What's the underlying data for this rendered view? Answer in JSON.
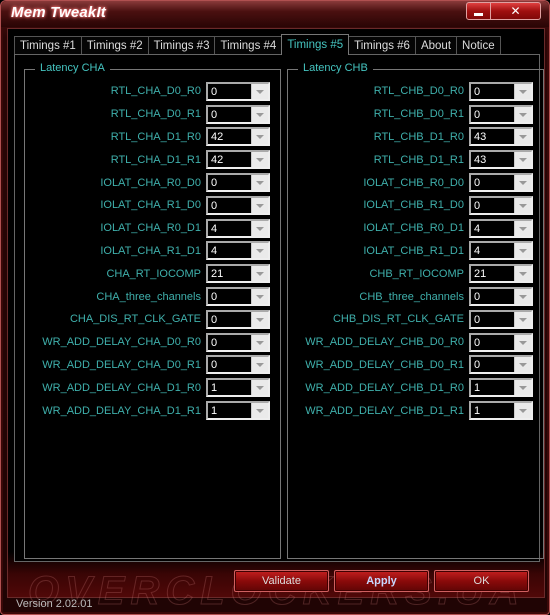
{
  "window": {
    "title": "Mem TweakIt",
    "minimize_glyph": "minimize-icon",
    "close_glyph": "✕"
  },
  "tabs": [
    {
      "label": "Timings #1",
      "active": false
    },
    {
      "label": "Timings #2",
      "active": false
    },
    {
      "label": "Timings #3",
      "active": false
    },
    {
      "label": "Timings #4",
      "active": false
    },
    {
      "label": "Timings #5",
      "active": true
    },
    {
      "label": "Timings #6",
      "active": false
    },
    {
      "label": "About",
      "active": false
    },
    {
      "label": "Notice",
      "active": false
    }
  ],
  "groups": {
    "cha": {
      "title": "Latency CHA",
      "rows": [
        {
          "label": "RTL_CHA_D0_R0",
          "value": "0"
        },
        {
          "label": "RTL_CHA_D0_R1",
          "value": "0"
        },
        {
          "label": "RTL_CHA_D1_R0",
          "value": "42"
        },
        {
          "label": "RTL_CHA_D1_R1",
          "value": "42"
        },
        {
          "label": "IOLAT_CHA_R0_D0",
          "value": "0"
        },
        {
          "label": "IOLAT_CHA_R1_D0",
          "value": "0"
        },
        {
          "label": "IOLAT_CHA_R0_D1",
          "value": "4"
        },
        {
          "label": "IOLAT_CHA_R1_D1",
          "value": "4"
        },
        {
          "label": "CHA_RT_IOCOMP",
          "value": "21"
        },
        {
          "label": "CHA_three_channels",
          "value": "0"
        },
        {
          "label": "CHA_DIS_RT_CLK_GATE",
          "value": "0"
        },
        {
          "label": "WR_ADD_DELAY_CHA_D0_R0",
          "value": "0"
        },
        {
          "label": "WR_ADD_DELAY_CHA_D0_R1",
          "value": "0"
        },
        {
          "label": "WR_ADD_DELAY_CHA_D1_R0",
          "value": "1"
        },
        {
          "label": "WR_ADD_DELAY_CHA_D1_R1",
          "value": "1"
        }
      ]
    },
    "chb": {
      "title": "Latency CHB",
      "rows": [
        {
          "label": "RTL_CHB_D0_R0",
          "value": "0"
        },
        {
          "label": "RTL_CHB_D0_R1",
          "value": "0"
        },
        {
          "label": "RTL_CHB_D1_R0",
          "value": "43"
        },
        {
          "label": "RTL_CHB_D1_R1",
          "value": "43"
        },
        {
          "label": "IOLAT_CHB_R0_D0",
          "value": "0"
        },
        {
          "label": "IOLAT_CHB_R1_D0",
          "value": "0"
        },
        {
          "label": "IOLAT_CHB_R0_D1",
          "value": "4"
        },
        {
          "label": "IOLAT_CHB_R1_D1",
          "value": "4"
        },
        {
          "label": "CHB_RT_IOCOMP",
          "value": "21"
        },
        {
          "label": "CHB_three_channels",
          "value": "0"
        },
        {
          "label": "CHB_DIS_RT_CLK_GATE",
          "value": "0"
        },
        {
          "label": "WR_ADD_DELAY_CHB_D0_R0",
          "value": "0"
        },
        {
          "label": "WR_ADD_DELAY_CHB_D0_R1",
          "value": "0"
        },
        {
          "label": "WR_ADD_DELAY_CHB_D1_R0",
          "value": "1"
        },
        {
          "label": "WR_ADD_DELAY_CHB_D1_R1",
          "value": "1"
        }
      ]
    }
  },
  "buttons": {
    "validate": "Validate",
    "apply": "Apply",
    "ok": "OK"
  },
  "watermark": "OVERCLOCKERS.UA",
  "status": {
    "version": "Version 2.02.01"
  },
  "colors": {
    "accent_text": "#45c4c0",
    "frame_red": "#a01010"
  }
}
